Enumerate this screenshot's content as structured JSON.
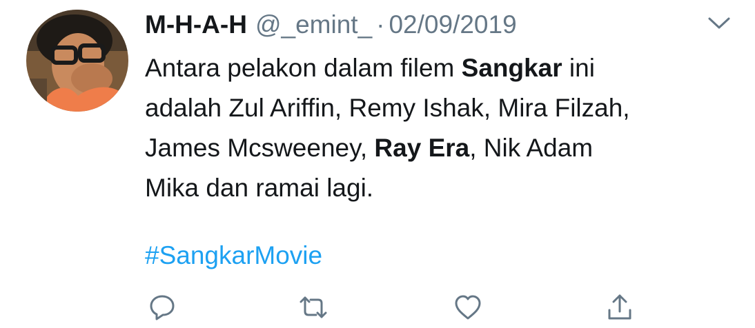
{
  "tweet": {
    "display_name": "M-H-A-H",
    "handle": "@_emint_",
    "separator": "·",
    "timestamp": "02/09/2019",
    "text_lines": [
      [
        "Antara pelakon dalam filem ",
        "Sangkar",
        " ini"
      ],
      [
        "adalah Zul Ariffin, Remy Ishak, Mira Filzah,"
      ],
      [
        "James Mcsweeney, ",
        "Ray Era",
        ", Nik Adam"
      ],
      [
        "Mika dan ramai lagi."
      ]
    ],
    "hashtag": "#SangkarMovie"
  },
  "icons": {
    "menu": "chevron-down-icon",
    "reply": "reply-icon",
    "retweet": "retweet-icon",
    "like": "heart-icon",
    "share": "share-icon"
  },
  "colors": {
    "text": "#14171a",
    "secondary": "#657786",
    "link": "#1da1f2",
    "icon": "#657786"
  }
}
